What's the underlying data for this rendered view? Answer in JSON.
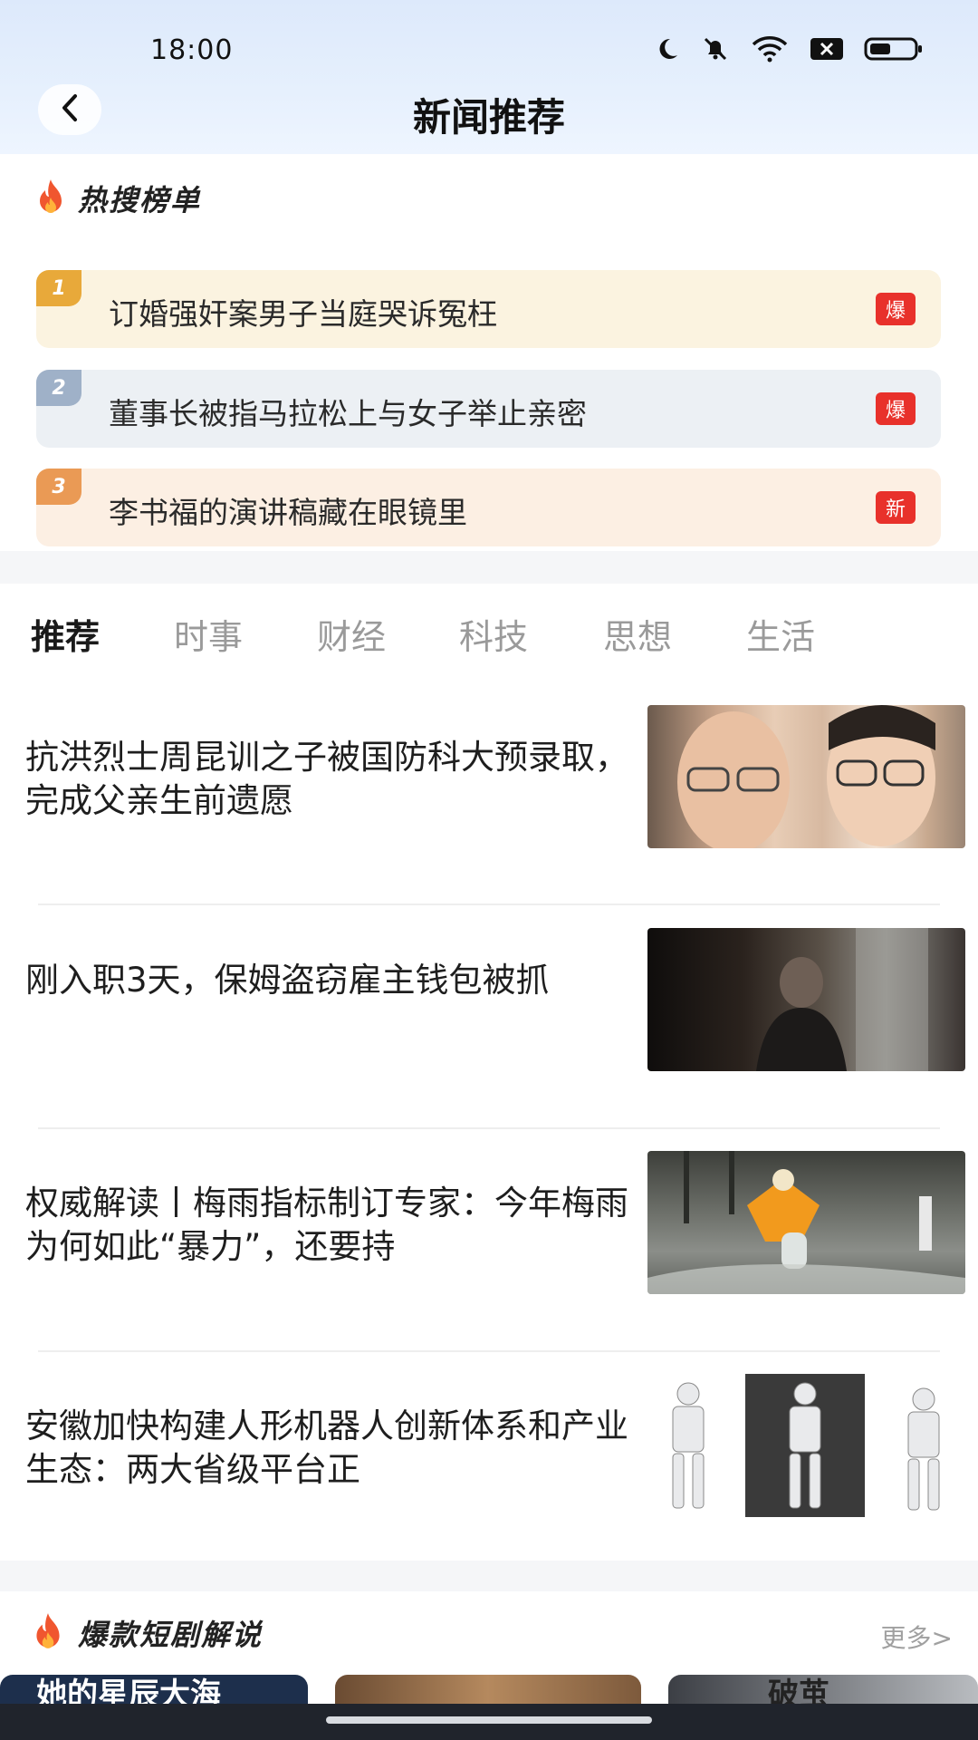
{
  "status_bar": {
    "time": "18:00"
  },
  "header": {
    "title": "新闻推荐"
  },
  "hot_list": {
    "title": "热搜榜单",
    "items": [
      {
        "rank": "1",
        "text": "订婚强奸案男子当庭哭诉冤枉",
        "badge": "爆"
      },
      {
        "rank": "2",
        "text": "董事长被指马拉松上与女子举止亲密",
        "badge": "爆"
      },
      {
        "rank": "3",
        "text": "李书福的演讲稿藏在眼镜里",
        "badge": "新"
      }
    ]
  },
  "tabs": [
    "推荐",
    "时事",
    "财经",
    "科技",
    "思想",
    "生活"
  ],
  "news": [
    {
      "title": "抗洪烈士周昆训之子被国防科大预录取，完成父亲生前遗愿"
    },
    {
      "title": "刚入职3天，保姆盗窃雇主钱包被抓"
    },
    {
      "title": "权威解读丨梅雨指标制订专家：今年梅雨为何如此“暴力”，还要持"
    },
    {
      "title": "安徽加快构建人形机器人创新体系和产业生态：两大省级平台正"
    }
  ],
  "short_drama": {
    "title": "爆款短剧解说",
    "more": "更多>",
    "cards": [
      {
        "text": "她的星辰大海"
      },
      {
        "text": ""
      },
      {
        "text": "破茧"
      }
    ]
  },
  "colors": {
    "accent_red": "#e8312b",
    "rank1": "#e8a93a",
    "rank2": "#9fb1c8",
    "rank3": "#ea9a55"
  }
}
